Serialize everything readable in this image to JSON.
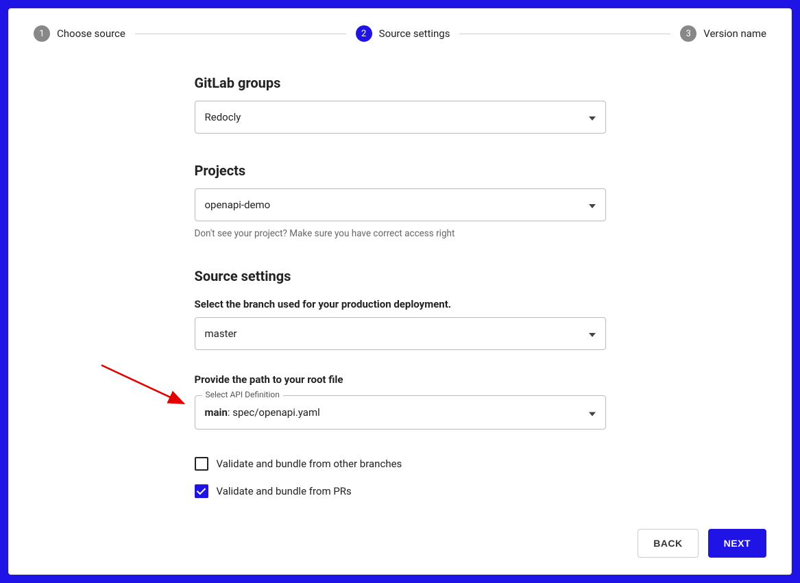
{
  "stepper": {
    "step1": {
      "num": "1",
      "label": "Choose source"
    },
    "step2": {
      "num": "2",
      "label": "Source settings"
    },
    "step3": {
      "num": "3",
      "label": "Version name"
    }
  },
  "groups": {
    "heading": "GitLab groups",
    "value": "Redocly"
  },
  "projects": {
    "heading": "Projects",
    "value": "openapi-demo",
    "helper": "Don't see your project? Make sure you have correct access right"
  },
  "sourceSettings": {
    "heading": "Source settings",
    "branchLabel": "Select the branch used for your production deployment.",
    "branchValue": "master",
    "rootLabel": "Provide the path to your root file",
    "apiDefLegend": "Select API Definition",
    "apiDefBold": "main",
    "apiDefRest": ": spec/openapi.yaml"
  },
  "checks": {
    "validateBranches": "Validate and bundle from other branches",
    "validatePRs": "Validate and bundle from PRs"
  },
  "buttons": {
    "back": "BACK",
    "next": "NEXT"
  }
}
